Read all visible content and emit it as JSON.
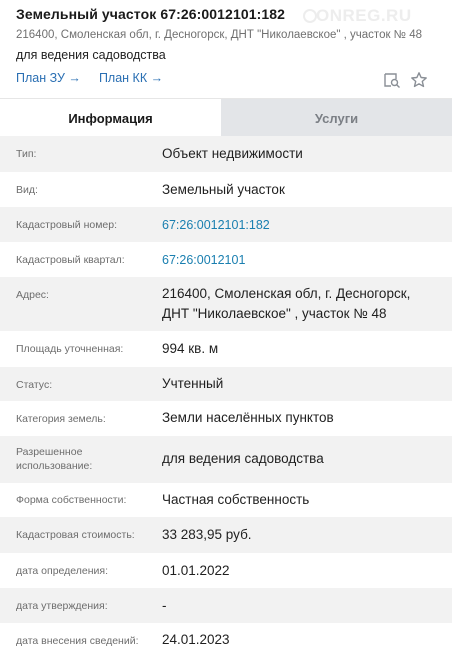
{
  "header": {
    "title": "Земельный участок 67:26:0012101:182",
    "address": "216400, Смоленская обл, г. Десногорск, ДНТ \"Николаевское\" , участок № 48",
    "purpose": "для ведения садоводства",
    "links": [
      "План ЗУ →",
      "План КК →"
    ],
    "watermark": "ONREG.RU",
    "icons": [
      "map-search-icon",
      "star-icon"
    ]
  },
  "tabs": {
    "info": "Информация",
    "services": "Услуги"
  },
  "rows": [
    {
      "label": "Тип:",
      "value": "Объект недвижимости"
    },
    {
      "label": "Вид:",
      "value": "Земельный участок"
    },
    {
      "label": "Кадастровый номер:",
      "value": "67:26:0012101:182"
    },
    {
      "label": "Кадастровый квартал:",
      "value": "67:26:0012101"
    },
    {
      "label": "Адрес:",
      "value_line1": "216400, Смоленская обл, г. Десногорск,",
      "value_line2": "ДНТ \"Николаевское\" , участок № 48"
    },
    {
      "label": "Площадь уточненная:",
      "value": "994 кв. м"
    },
    {
      "label": "Статус:",
      "value": "Учтенный"
    },
    {
      "label": "Категория земель:",
      "value": "Земли населённых пунктов"
    },
    {
      "label_line1": "Разрешенное",
      "label_line2": "использование:",
      "value": "для ведения садоводства"
    },
    {
      "label": "Форма собственности:",
      "value": "Частная собственность"
    },
    {
      "label": "Кадастровая стоимость:",
      "value": "33 283,95 руб."
    },
    {
      "label": "дата определения:",
      "value": "01.01.2022"
    },
    {
      "label": "дата утверждения:",
      "value": "-"
    },
    {
      "label": "дата внесения сведений:",
      "value": "24.01.2023"
    }
  ],
  "colors": {
    "link": "#2a6fb3",
    "cadastral_link": "#1a7fb0",
    "stripe": "#f2f2f2",
    "inactive_tab": "#e3e5e8"
  }
}
